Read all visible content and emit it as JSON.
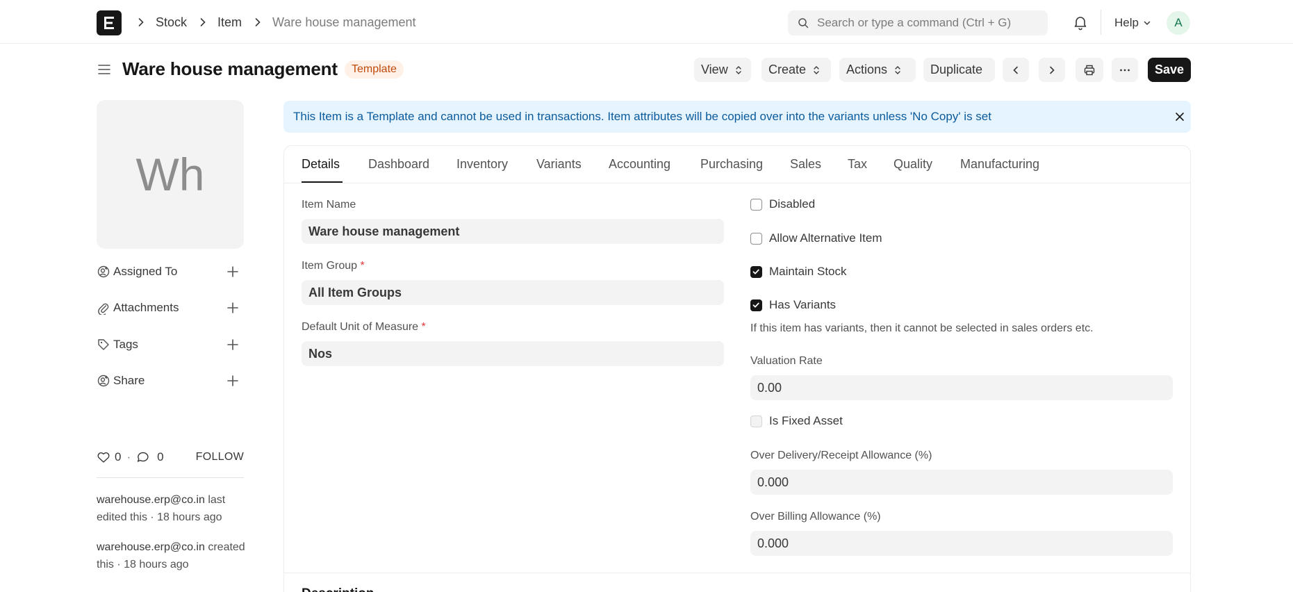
{
  "navbar": {
    "breadcrumbs": [
      "Stock",
      "Item",
      "Ware house management"
    ],
    "search_placeholder": "Search or type a command (Ctrl + G)",
    "help_label": "Help",
    "avatar_initial": "A"
  },
  "page": {
    "title": "Ware house management",
    "badge": "Template",
    "buttons": {
      "view": "View",
      "create": "Create",
      "actions": "Actions",
      "duplicate": "Duplicate",
      "save": "Save"
    }
  },
  "sidebar": {
    "image_initials": "Wh",
    "items": [
      {
        "label": "Assigned To",
        "icon": "user-plus-icon"
      },
      {
        "label": "Attachments",
        "icon": "paperclip-icon"
      },
      {
        "label": "Tags",
        "icon": "tag-icon"
      },
      {
        "label": "Share",
        "icon": "share-user-icon"
      }
    ],
    "likes": "0",
    "comments": "0",
    "follow_label": "FOLLOW",
    "activity": [
      {
        "who": "warehouse.erp@co.in",
        "text": " last edited this · 18 hours ago"
      },
      {
        "who": "warehouse.erp@co.in",
        "text": " created this · 18 hours ago"
      }
    ]
  },
  "alert": {
    "text": "This Item is a Template and cannot be used in transactions. Item attributes will be copied over into the variants unless 'No Copy' is set"
  },
  "tabs": [
    "Details",
    "Dashboard",
    "Inventory",
    "Variants",
    "Accounting",
    "Purchasing",
    "Sales",
    "Tax",
    "Quality",
    "Manufacturing"
  ],
  "form": {
    "item_name_label": "Item Name",
    "item_name_value": "Ware house management",
    "item_group_label": "Item Group",
    "item_group_value": "All Item Groups",
    "uom_label": "Default Unit of Measure",
    "uom_value": "Nos",
    "required_mark": "*",
    "disabled_label": "Disabled",
    "allow_alt_label": "Allow Alternative Item",
    "maintain_stock_label": "Maintain Stock",
    "has_variants_label": "Has Variants",
    "has_variants_help": "If this item has variants, then it cannot be selected in sales orders etc.",
    "valuation_rate_label": "Valuation Rate",
    "valuation_rate_value": "0.00",
    "fixed_asset_label": "Is Fixed Asset",
    "over_delivery_label": "Over Delivery/Receipt Allowance (%)",
    "over_delivery_value": "0.000",
    "over_billing_label": "Over Billing Allowance (%)",
    "over_billing_value": "0.000",
    "checks": {
      "disabled": false,
      "allow_alternative": false,
      "maintain_stock": true,
      "has_variants": true,
      "is_fixed_asset": false
    },
    "section_title": "Description"
  }
}
